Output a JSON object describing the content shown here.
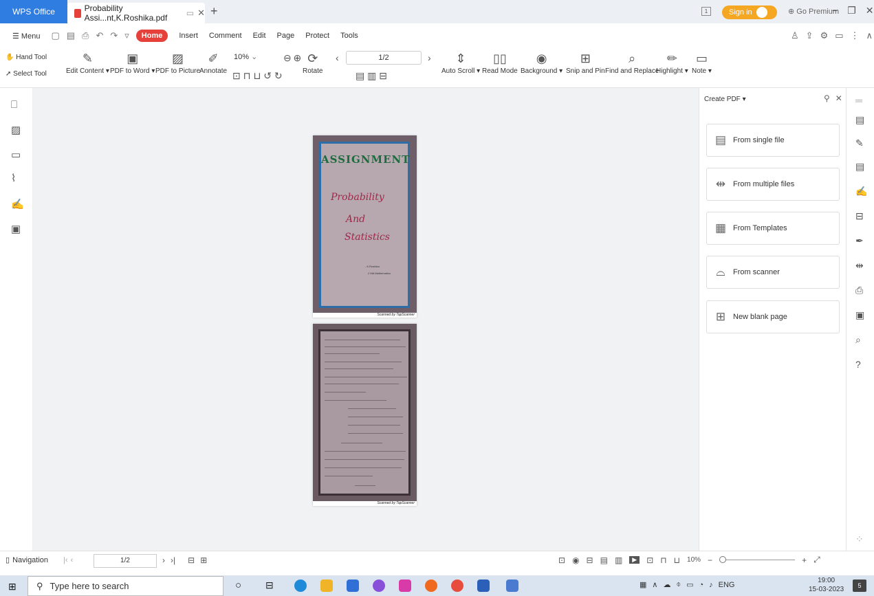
{
  "titlebar": {
    "app_name": "WPS Office",
    "doc_tab": "Probability Assi...nt,K.Roshika.pdf",
    "sign_in": "Sign in",
    "premium": "Go Premium",
    "page_badge": "1"
  },
  "menubar": {
    "menu": "Menu",
    "items": [
      "Home",
      "Insert",
      "Comment",
      "Edit",
      "Page",
      "Protect",
      "Tools"
    ]
  },
  "ribbon": {
    "hand_tool": "Hand Tool",
    "select_tool": "Select Tool",
    "edit_content": "Edit Content",
    "pdf_to_word": "PDF to Word",
    "pdf_to_picture": "PDF to Picture",
    "annotate": "Annotate",
    "zoom": "10%",
    "rotate": "Rotate",
    "page_indicator": "1/2",
    "auto_scroll": "Auto Scroll",
    "read_mode": "Read Mode",
    "background": "Background",
    "snip_and_pin": "Snip and Pin",
    "find_and_replace": "Find and Replace",
    "highlight": "Highlight",
    "note": "Note"
  },
  "document": {
    "page1_heading": "ASSIGNMENT",
    "page1_line1": "Probability",
    "page1_line2": "And",
    "page1_line3": "Statistics",
    "page1_small1": "- K.Roshika",
    "page1_small2": "2 MA Mathematics",
    "scan_label": "Scanned by TapScanner"
  },
  "right_panel": {
    "title": "Create PDF",
    "options": [
      {
        "label": "From single file",
        "icon": "file-add-icon"
      },
      {
        "label": "From multiple files",
        "icon": "merge-files-icon"
      },
      {
        "label": "From Templates",
        "icon": "template-icon"
      },
      {
        "label": "From scanner",
        "icon": "scanner-icon"
      },
      {
        "label": "New blank page",
        "icon": "plus-icon"
      }
    ]
  },
  "statusbar": {
    "navigation": "Navigation",
    "page": "1/2",
    "zoom": "10%"
  },
  "taskbar": {
    "search_placeholder": "Type here to search",
    "lang": "ENG",
    "time": "19:00",
    "date": "15-03-2023",
    "notif_count": "5"
  }
}
